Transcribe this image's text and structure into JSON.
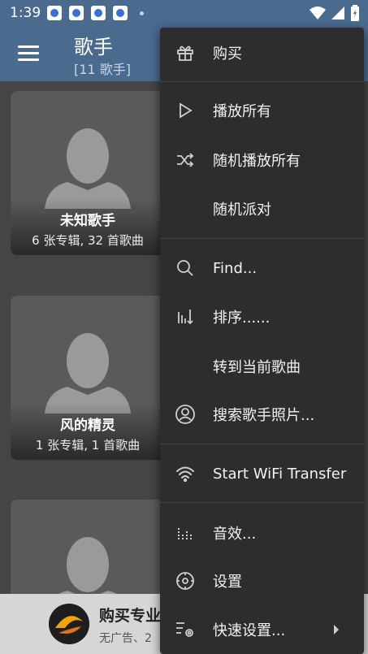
{
  "status_bar": {
    "time": "1:39",
    "notification_icons": [
      "baidu-icon",
      "baidu-icon",
      "baidu-icon",
      "baidu-icon"
    ],
    "system_icons": [
      "wifi-icon",
      "signal-icon",
      "battery-icon"
    ]
  },
  "app_bar": {
    "title": "歌手",
    "subtitle": "[11 歌手]",
    "background": "#4a6a8e"
  },
  "artists": [
    {
      "name": "未知歌手",
      "meta": "6 张专辑, 32 首歌曲"
    },
    {
      "name": "风的精灵",
      "meta": "1 张专辑, 1 首歌曲"
    },
    {
      "name": "",
      "meta": ""
    }
  ],
  "promo": {
    "title": "购买专业",
    "subtitle": "无广告、2"
  },
  "menu": {
    "items": [
      {
        "label": "购买",
        "icon": "gift-icon"
      },
      {
        "label": "播放所有",
        "icon": "play-icon"
      },
      {
        "label": "随机播放所有",
        "icon": "shuffle-icon"
      },
      {
        "label": "随机派对",
        "icon": ""
      },
      {
        "label": "Find...",
        "icon": "search-icon"
      },
      {
        "label": "排序......",
        "icon": "sort-icon"
      },
      {
        "label": "转到当前歌曲",
        "icon": ""
      },
      {
        "label": "搜索歌手照片...",
        "icon": "account-circle-icon"
      },
      {
        "label": "Start WiFi Transfer",
        "icon": "wifi-icon"
      },
      {
        "label": "音效...",
        "icon": "equalizer-icon"
      },
      {
        "label": "设置",
        "icon": "settings-icon"
      },
      {
        "label": "快速设置...",
        "icon": "tune-icon"
      }
    ]
  }
}
